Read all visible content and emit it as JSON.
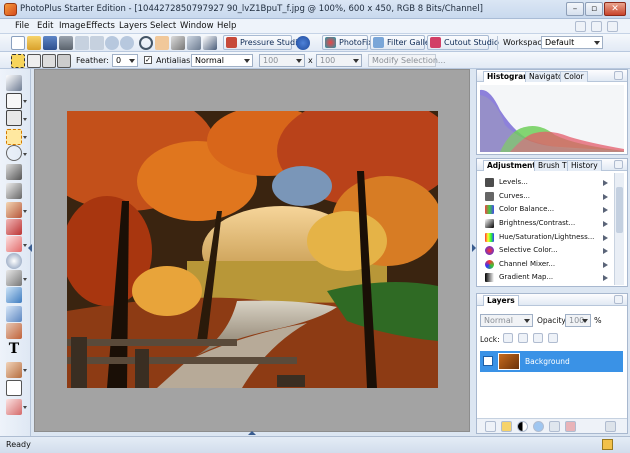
{
  "window": {
    "title": "PhotoPlus Starter Edition - [1044272850797927 90_lvZ1BpuT_f.jpg @ 100%, 600 x 450, RGB 8 Bits/Channel]"
  },
  "menu": [
    "File",
    "Edit",
    "Image",
    "Effects",
    "Layers",
    "Select",
    "Window",
    "Help"
  ],
  "toolbar": {
    "pressure_studio": "Pressure Studio",
    "photofix": "PhotoFix",
    "filter_gallery": "Filter Gallery",
    "cutout_studio": "Cutout Studio",
    "workspace_label": "Workspace",
    "workspace_value": "Default"
  },
  "context": {
    "feather_label": "Feather:",
    "feather_value": "0",
    "antialias_label": "Antialias",
    "blend_mode": "Normal",
    "width_value": "100",
    "x_label": "x",
    "height_value": "100",
    "modify_selection": "Modify Selection..."
  },
  "panels": {
    "histogram_tabs": [
      "Histogram",
      "Navigator",
      "Color"
    ],
    "adjust_tabs": [
      "Adjustments",
      "Brush Tip",
      "History"
    ],
    "adjustments": [
      "Levels...",
      "Curves...",
      "Color Balance...",
      "Brightness/Contrast...",
      "Hue/Saturation/Lightness...",
      "Selective Color...",
      "Channel Mixer...",
      "Gradient Map..."
    ],
    "layers_title": "Layers",
    "layer_blend": "Normal",
    "opacity_label": "Opacity:",
    "opacity_value": "100",
    "opacity_unit": "%",
    "lock_label": "Lock:",
    "layer_name": "Background"
  },
  "status": {
    "text": "Ready"
  },
  "colors": {
    "accent": "#3b8fe0",
    "selected_layer": "#3a92e6"
  }
}
